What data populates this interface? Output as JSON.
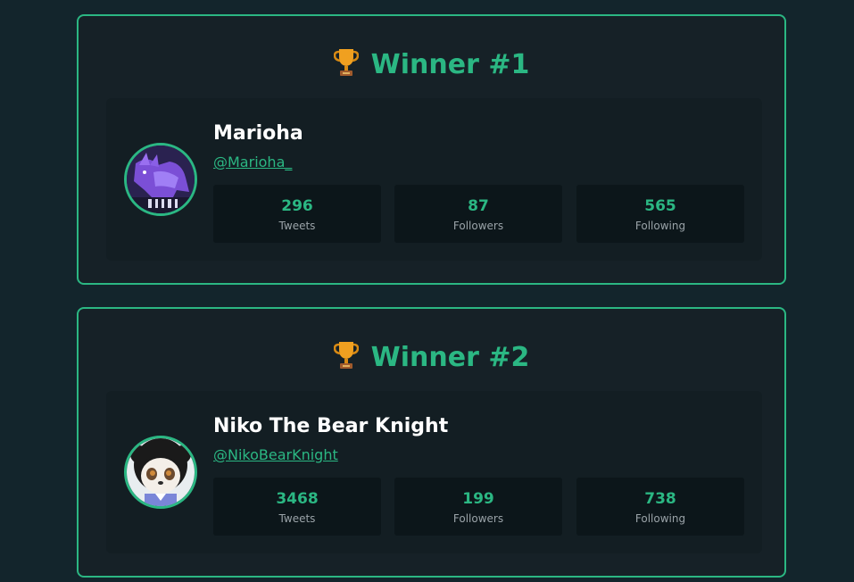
{
  "winners": [
    {
      "title": "Winner #1",
      "name": "Marioha",
      "handle": "@Marioha_",
      "stats": [
        {
          "value": "296",
          "label": "Tweets"
        },
        {
          "value": "87",
          "label": "Followers"
        },
        {
          "value": "565",
          "label": "Following"
        }
      ]
    },
    {
      "title": "Winner #2",
      "name": "Niko The Bear Knight",
      "handle": "@NikoBearKnight",
      "stats": [
        {
          "value": "3468",
          "label": "Tweets"
        },
        {
          "value": "199",
          "label": "Followers"
        },
        {
          "value": "738",
          "label": "Following"
        }
      ]
    }
  ],
  "icons": {
    "trophy": "trophy-icon"
  },
  "colors": {
    "accent": "#2bb783",
    "background": "#13252c",
    "card": "#162127"
  }
}
